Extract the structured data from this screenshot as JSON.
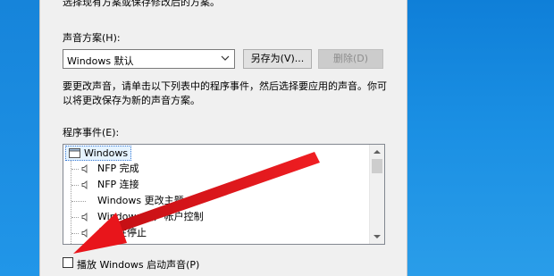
{
  "dialog": {
    "top_partial_text": "选择现有方案或保存修改后的方案。",
    "scheme_label": "声音方案(H):",
    "scheme_value": "Windows 默认",
    "save_as_label": "另存为(V)...",
    "delete_label": "删除(D)",
    "description": [
      "要更改声音，请单击以下列表中的程序事件，然后选择要应用的声音。你可",
      "以将更改保存为新的声音方案。"
    ],
    "events_label": "程序事件(E):",
    "tree_root": "Windows",
    "tree_items": [
      {
        "label": "NFP 完成",
        "has_sound": true
      },
      {
        "label": "NFP 连接",
        "has_sound": true
      },
      {
        "label": "Windows 更改主题",
        "has_sound": false
      },
      {
        "label": "Windows 用户帐户控制",
        "has_sound": true
      },
      {
        "label": "关键性停止",
        "has_sound": true
      }
    ],
    "startup_checkbox_label": "播放 Windows 启动声音(P)",
    "startup_checked": false
  },
  "annotation": {
    "arrow_color": "#e8151b"
  }
}
